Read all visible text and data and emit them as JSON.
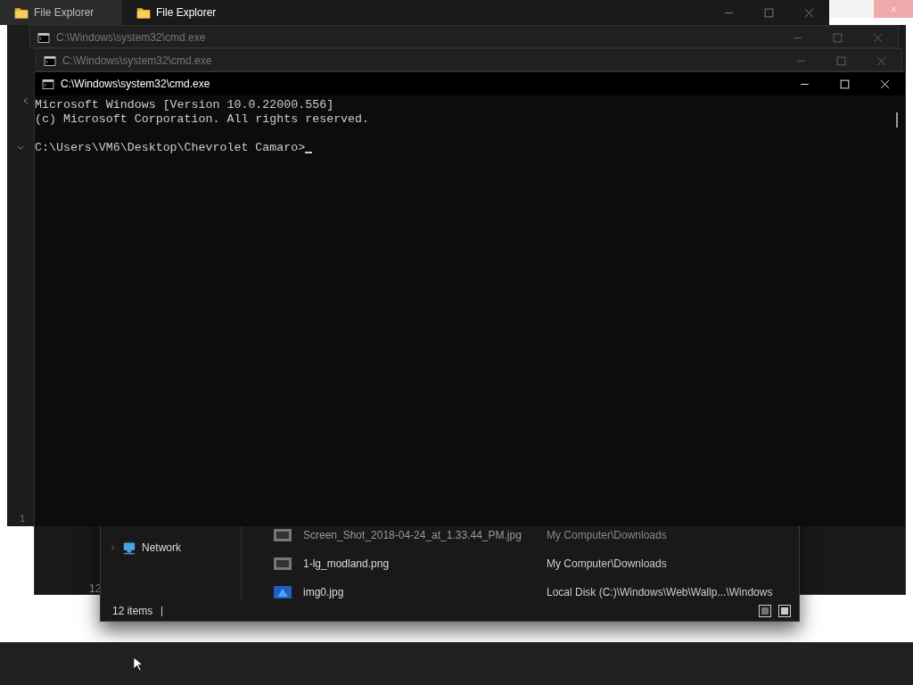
{
  "explorer_tabs": [
    {
      "title": "File Explorer",
      "active": false
    },
    {
      "title": "File Explorer",
      "active": true
    }
  ],
  "background_fragments": {
    "left_status": "1",
    "behind_status": "12"
  },
  "explorer": {
    "nav_items": [
      {
        "label": "Network"
      }
    ],
    "files": [
      {
        "name": "Screen_Shot_2018-04-24_at_1.33.44_PM.jpg",
        "location": "My Computer\\Downloads"
      },
      {
        "name": "1-lg_modland.png",
        "location": "My Computer\\Downloads"
      },
      {
        "name": "img0.jpg",
        "location": "Local Disk (C:)\\Windows\\Web\\Wallp...\\Windows"
      }
    ],
    "status": "12 items"
  },
  "cmd_windows": [
    {
      "title": "C:\\Windows\\system32\\cmd.exe",
      "active": false
    },
    {
      "title": "C:\\Windows\\system32\\cmd.exe",
      "active": false
    },
    {
      "title": "C:\\Windows\\system32\\cmd.exe",
      "active": true
    }
  ],
  "console": {
    "lines": [
      "Microsoft Windows [Version 10.0.22000.556]",
      "(c) Microsoft Corporation. All rights reserved."
    ],
    "prompt": "C:\\Users\\VM6\\Desktop\\Chevrolet Camaro>"
  }
}
